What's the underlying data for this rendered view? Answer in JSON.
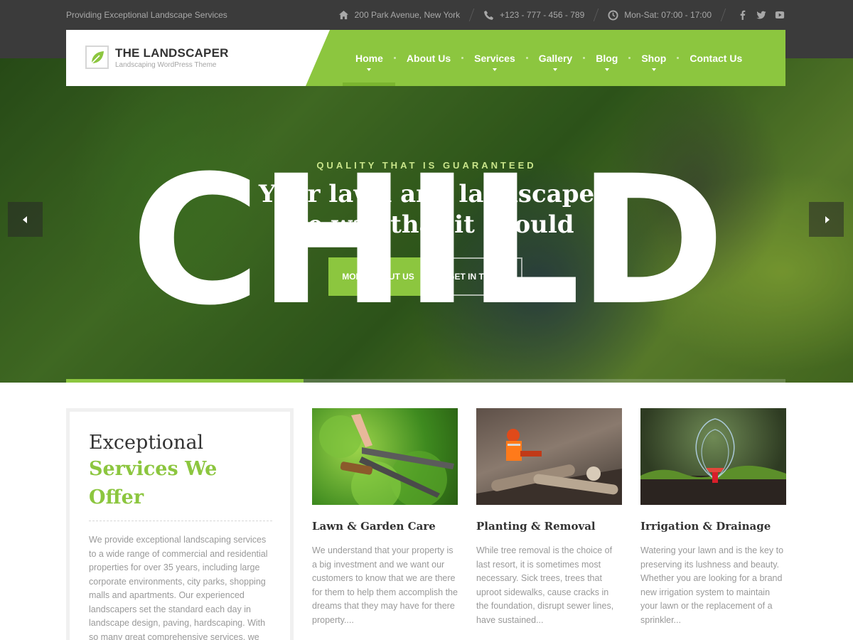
{
  "topbar": {
    "tagline": "Providing Exceptional Landscape Services",
    "address": "200 Park Avenue, New York",
    "phone": "+123 - 777 - 456 - 789",
    "hours": "Mon-Sat: 07:00 - 17:00",
    "social": [
      "facebook-icon",
      "twitter-icon",
      "youtube-icon"
    ]
  },
  "logo": {
    "name": "THE LANDSCAPER",
    "subtitle": "Landscaping WordPress Theme"
  },
  "nav": {
    "items": [
      {
        "label": "Home",
        "has_dropdown": true,
        "active": true
      },
      {
        "label": "About Us",
        "has_dropdown": false
      },
      {
        "label": "Services",
        "has_dropdown": true
      },
      {
        "label": "Gallery",
        "has_dropdown": true
      },
      {
        "label": "Blog",
        "has_dropdown": true
      },
      {
        "label": "Shop",
        "has_dropdown": true
      },
      {
        "label": "Contact Us",
        "has_dropdown": false
      }
    ]
  },
  "hero": {
    "subtitle": "QUALITY THAT IS GUARANTEED",
    "title_line1": "Your lawn and landscape",
    "title_line2": "the way that it should",
    "primary_button": "MORE ABOUT US",
    "secondary_button": "GET IN TOUCH",
    "watermark": "CHILD",
    "slider_progress": 0.33
  },
  "intro": {
    "title_line1": "Exceptional",
    "title_line2": "Services We Offer",
    "text": "We provide exceptional landscaping services to a wide range of commercial and residential properties for over 35 years, including large corporate environments, city parks, shopping malls and apartments. Our experienced landscapers set the standard each day in landscape design, paving, hardscaping. With so many great comprehensive services, we will whip your yard into shape in no time."
  },
  "services": [
    {
      "title": "Lawn & Garden Care",
      "text": "We understand that your property is a big investment and we want our customers to know that we are there for them to help them accomplish the dreams that they may have for there property...."
    },
    {
      "title": "Planting & Removal",
      "text": "While tree removal is the choice of last resort, it is sometimes most necessary. Sick trees, trees that uproot sidewalks, cause cracks in the foundation, disrupt sewer lines, have sustained..."
    },
    {
      "title": "Irrigation & Drainage",
      "text": "Watering your lawn and is the key to preserving its lushness and beauty. Whether you are looking for a brand new irrigation system to maintain your lawn or the replacement of a sprinkler..."
    }
  ],
  "colors": {
    "accent": "#8cc63f",
    "topbar": "#3b3b3b",
    "text_muted": "#999999"
  }
}
